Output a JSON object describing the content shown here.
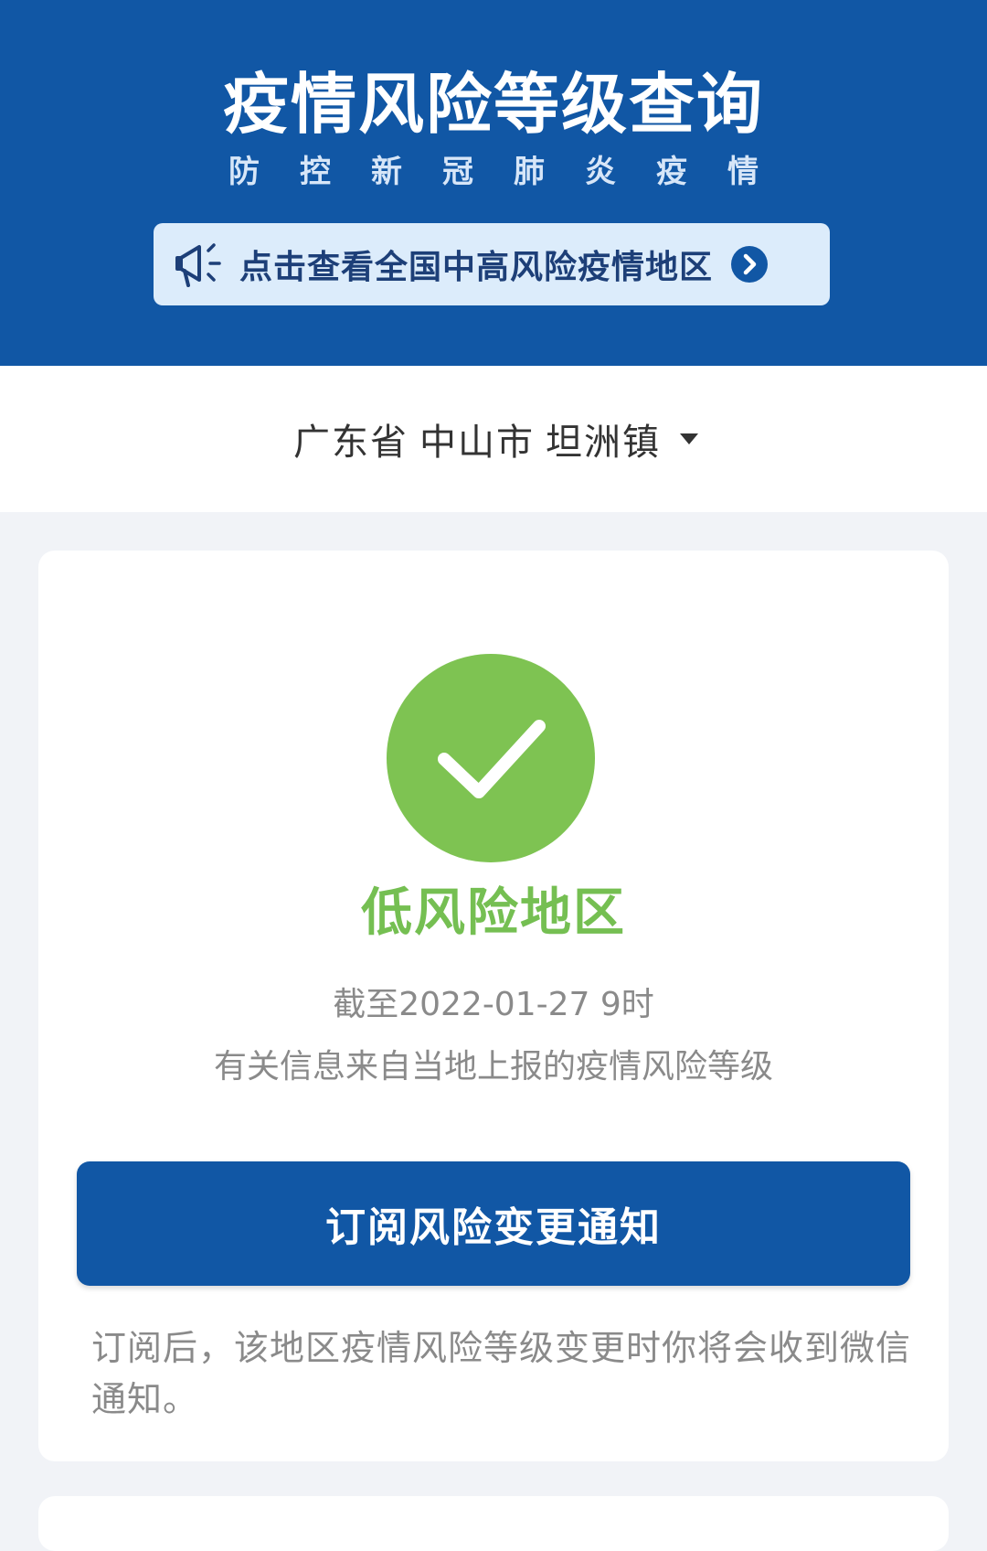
{
  "header": {
    "title": "疫情风险等级查询",
    "subtitle": "防控新冠肺炎疫情",
    "banner": {
      "text": "点击查看全国中高风险疫情地区",
      "icon": "megaphone-icon",
      "arrow_icon": "chevron-right-circle-icon"
    },
    "background_color": "#1157a5"
  },
  "location": {
    "province": "广东省",
    "city": "中山市",
    "town": "坦洲镇",
    "dropdown_icon": "caret-down-icon"
  },
  "result": {
    "status_icon": "check-circle-icon",
    "status_color": "#75bf52",
    "risk_level": "低风险地区",
    "timestamp": "截至2022-01-27 9时",
    "source": "有关信息来自当地上报的疫情风险等级",
    "subscribe_button": "订阅风险变更通知",
    "note": "订阅后，该地区疫情风险等级变更时你将会收到微信通知。"
  }
}
